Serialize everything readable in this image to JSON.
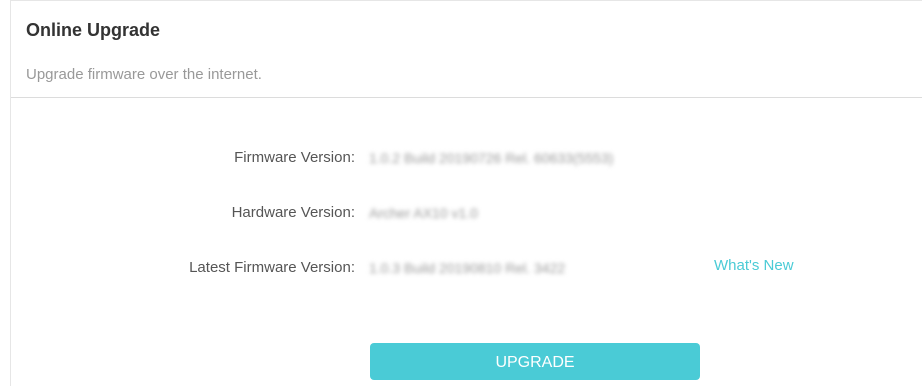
{
  "section": {
    "title": "Online Upgrade",
    "description": "Upgrade firmware over the internet."
  },
  "rows": [
    {
      "label": "Firmware Version:",
      "value": "1.0.2 Build 20190726 Rel. 60633(5553)"
    },
    {
      "label": "Hardware Version:",
      "value": "Archer AX10 v1.0"
    },
    {
      "label": "Latest Firmware Version:",
      "value": "1.0.3 Build 20190810 Rel. 3422"
    }
  ],
  "whats_new_link": "What's New",
  "upgrade_button": "UPGRADE",
  "colors": {
    "accent": "#4acbd6",
    "title": "#333333",
    "subtitle": "#999999"
  }
}
